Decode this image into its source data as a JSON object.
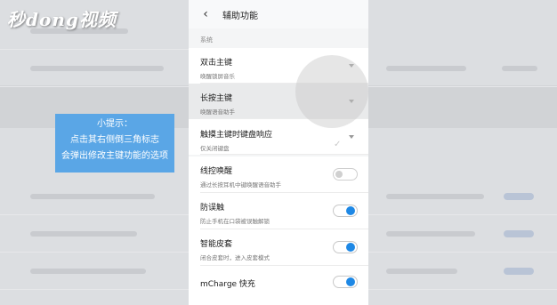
{
  "watermark": {
    "logo_text": "秒dong视频"
  },
  "tip": {
    "line1": "小提示：",
    "line2": "点击其右侧倒三角标志",
    "line3": "会弹出修改主键功能的选项"
  },
  "header": {
    "title": "辅助功能"
  },
  "section_label": "系统",
  "items": [
    {
      "label": "双击主键",
      "sub": "唤醒锁屏音乐",
      "control": "chevron"
    },
    {
      "label": "长按主键",
      "sub": "唤醒语音助手",
      "control": "chevron"
    },
    {
      "label": "触摸主键时键盘响应",
      "sub": "仅关闭键盘",
      "control": "chevron"
    },
    {
      "label": "线控唤醒",
      "sub": "通过长按耳机中键唤醒语音助手",
      "control": "toggle",
      "on": false
    },
    {
      "label": "防误触",
      "sub": "防止手机在口袋被误触解锁",
      "control": "toggle",
      "on": true
    },
    {
      "label": "智能皮套",
      "sub": "闭合皮套时，进入皮套模式",
      "control": "toggle",
      "on": true
    },
    {
      "label": "mCharge 快充",
      "sub": "",
      "control": "toggle",
      "on": true
    }
  ],
  "colors": {
    "accent": "#1e88e5",
    "tip_bg": "#5aa6e6"
  }
}
